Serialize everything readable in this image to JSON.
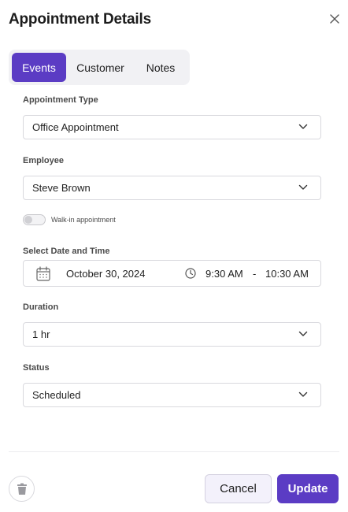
{
  "header": {
    "title": "Appointment Details"
  },
  "tabs": [
    {
      "label": "Events",
      "active": true
    },
    {
      "label": "Customer",
      "active": false
    },
    {
      "label": "Notes",
      "active": false
    }
  ],
  "appointment_type": {
    "label": "Appointment Type",
    "value": "Office Appointment"
  },
  "employee": {
    "label": "Employee",
    "value": "Steve Brown"
  },
  "walk_in": {
    "label": "Walk-in appointment",
    "on": false
  },
  "datetime": {
    "label": "Select Date and Time",
    "date": "October 30, 2024",
    "start": "9:30 AM",
    "separator": "-",
    "end": "10:30 AM"
  },
  "duration": {
    "label": "Duration",
    "value": "1 hr"
  },
  "status": {
    "label": "Status",
    "value": "Scheduled"
  },
  "footer": {
    "cancel_label": "Cancel",
    "update_label": "Update"
  },
  "colors": {
    "accent": "#5b3cc4",
    "border": "#d9d9de",
    "tab_bg": "#f1f1f4"
  },
  "icons": [
    "close-icon",
    "chevron-down-icon",
    "calendar-icon",
    "clock-icon",
    "trash-icon"
  ]
}
